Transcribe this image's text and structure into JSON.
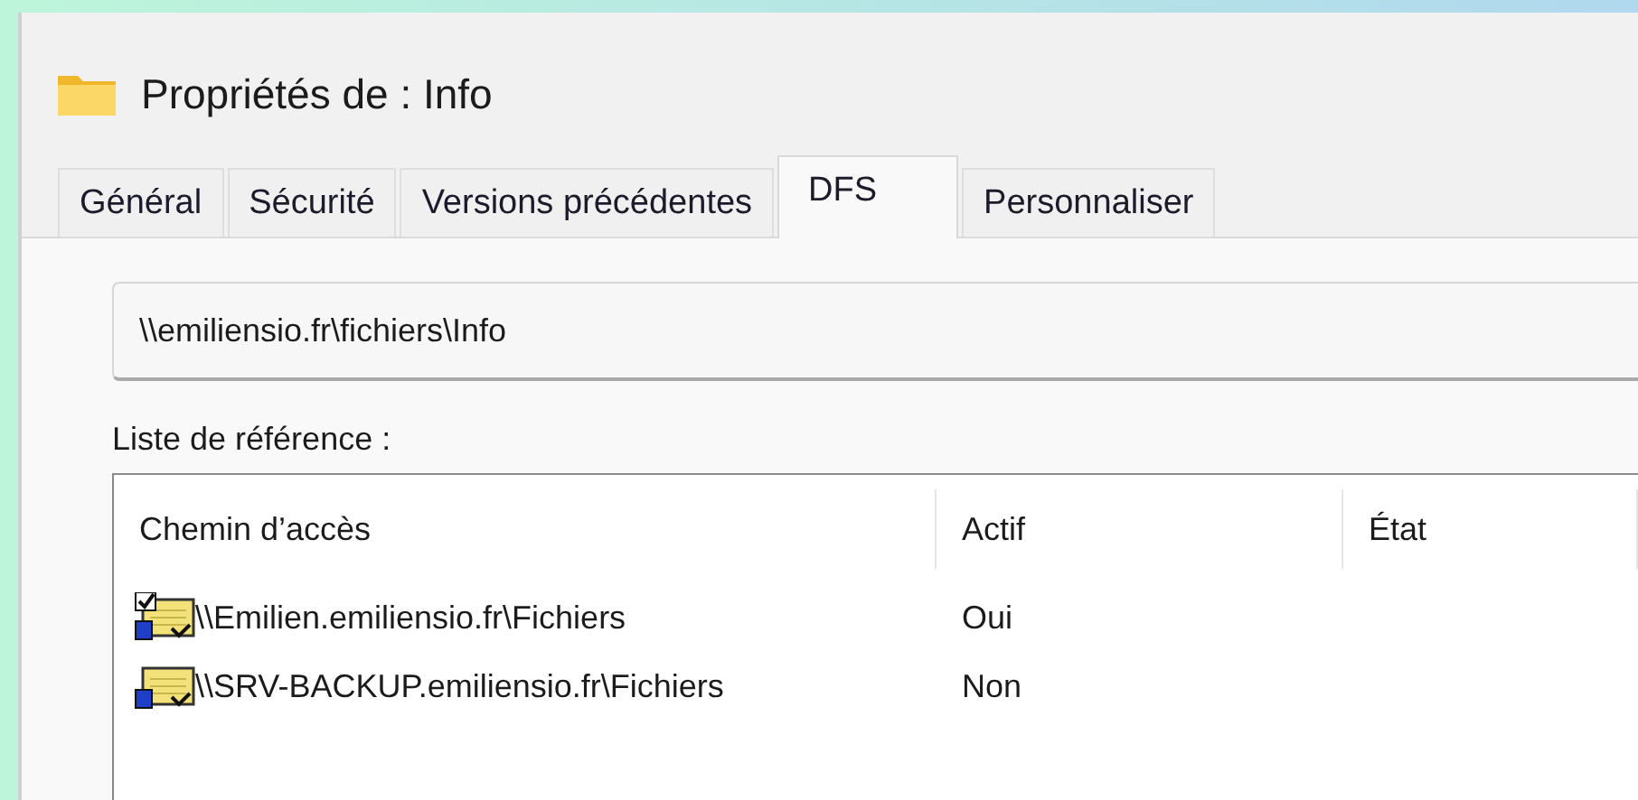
{
  "window": {
    "title": "Propriétés de : Info"
  },
  "tabs": [
    {
      "label": "Général",
      "selected": false
    },
    {
      "label": "Sécurité",
      "selected": false
    },
    {
      "label": "Versions précédentes",
      "selected": false
    },
    {
      "label": "DFS",
      "selected": true
    },
    {
      "label": "Personnaliser",
      "selected": false
    }
  ],
  "path_field": {
    "value": "\\\\emiliensio.fr\\fichiers\\Info"
  },
  "referral_list": {
    "label": "Liste de référence :",
    "columns": [
      "Chemin d’accès",
      "Actif",
      "État"
    ],
    "rows": [
      {
        "path": "\\\\Emilien.emiliensio.fr\\Fichiers",
        "active": "Oui",
        "checked": true
      },
      {
        "path": "\\\\SRV-BACKUP.emiliensio.fr\\Fichiers",
        "active": "Non",
        "checked": false
      }
    ]
  }
}
